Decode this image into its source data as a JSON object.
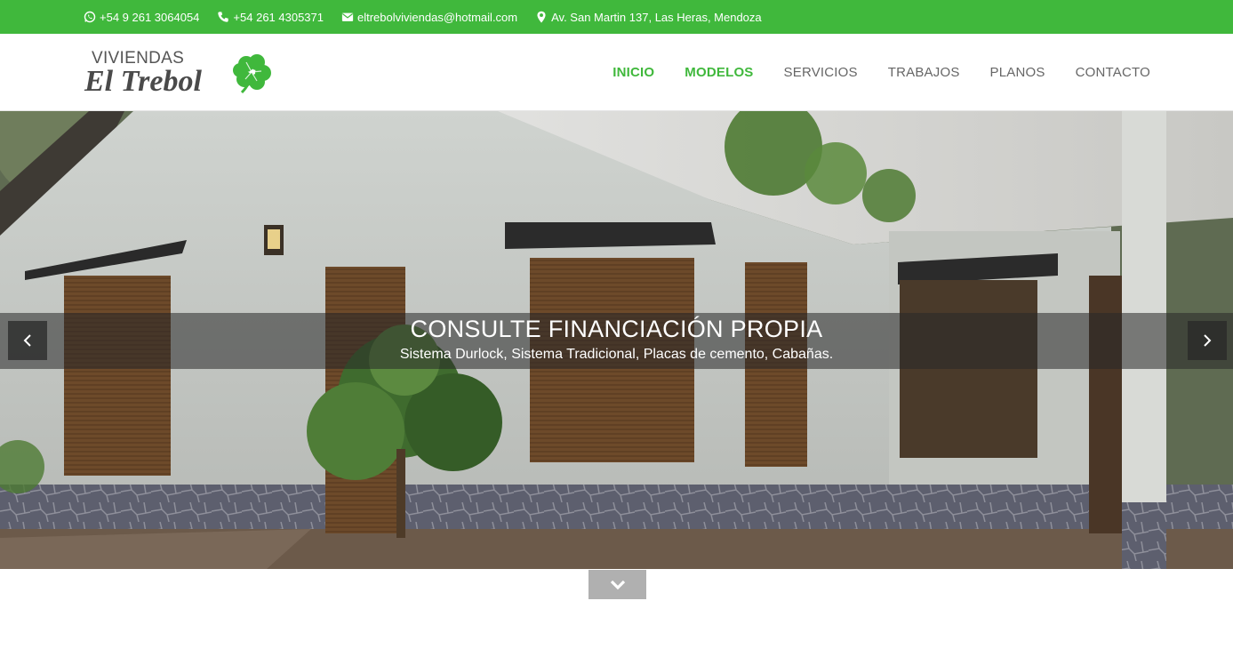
{
  "topbar": {
    "whatsapp": "+54 9 261 3064054",
    "phone": "+54 261 4305371",
    "email": "eltrebolviviendas@hotmail.com",
    "address": "Av. San Martin 137, Las Heras, Mendoza",
    "background_color": "#40b83c",
    "icons": [
      "whatsapp-icon",
      "phone-icon",
      "envelope-icon",
      "map-marker-icon"
    ]
  },
  "logo": {
    "small_text": "VIVIENDAS",
    "big_text": "El Trebol",
    "icon": "clover-icon"
  },
  "nav": {
    "items": [
      {
        "label": "INICIO",
        "active": true
      },
      {
        "label": "MODELOS",
        "active": true
      },
      {
        "label": "SERVICIOS",
        "active": false
      },
      {
        "label": "TRABAJOS",
        "active": false
      },
      {
        "label": "PLANOS",
        "active": false
      },
      {
        "label": "CONTACTO",
        "active": false
      }
    ],
    "active_color": "#40b83c"
  },
  "hero": {
    "title": "CONSULTE FINANCIACIÓN PROPIA",
    "subtitle": "Sistema Durlock, Sistema Tradicional, Placas de cemento, Cabañas.",
    "prev_icon": "chevron-left-icon",
    "next_icon": "chevron-right-icon"
  },
  "scroll_down": {
    "icon": "chevron-down-icon"
  }
}
